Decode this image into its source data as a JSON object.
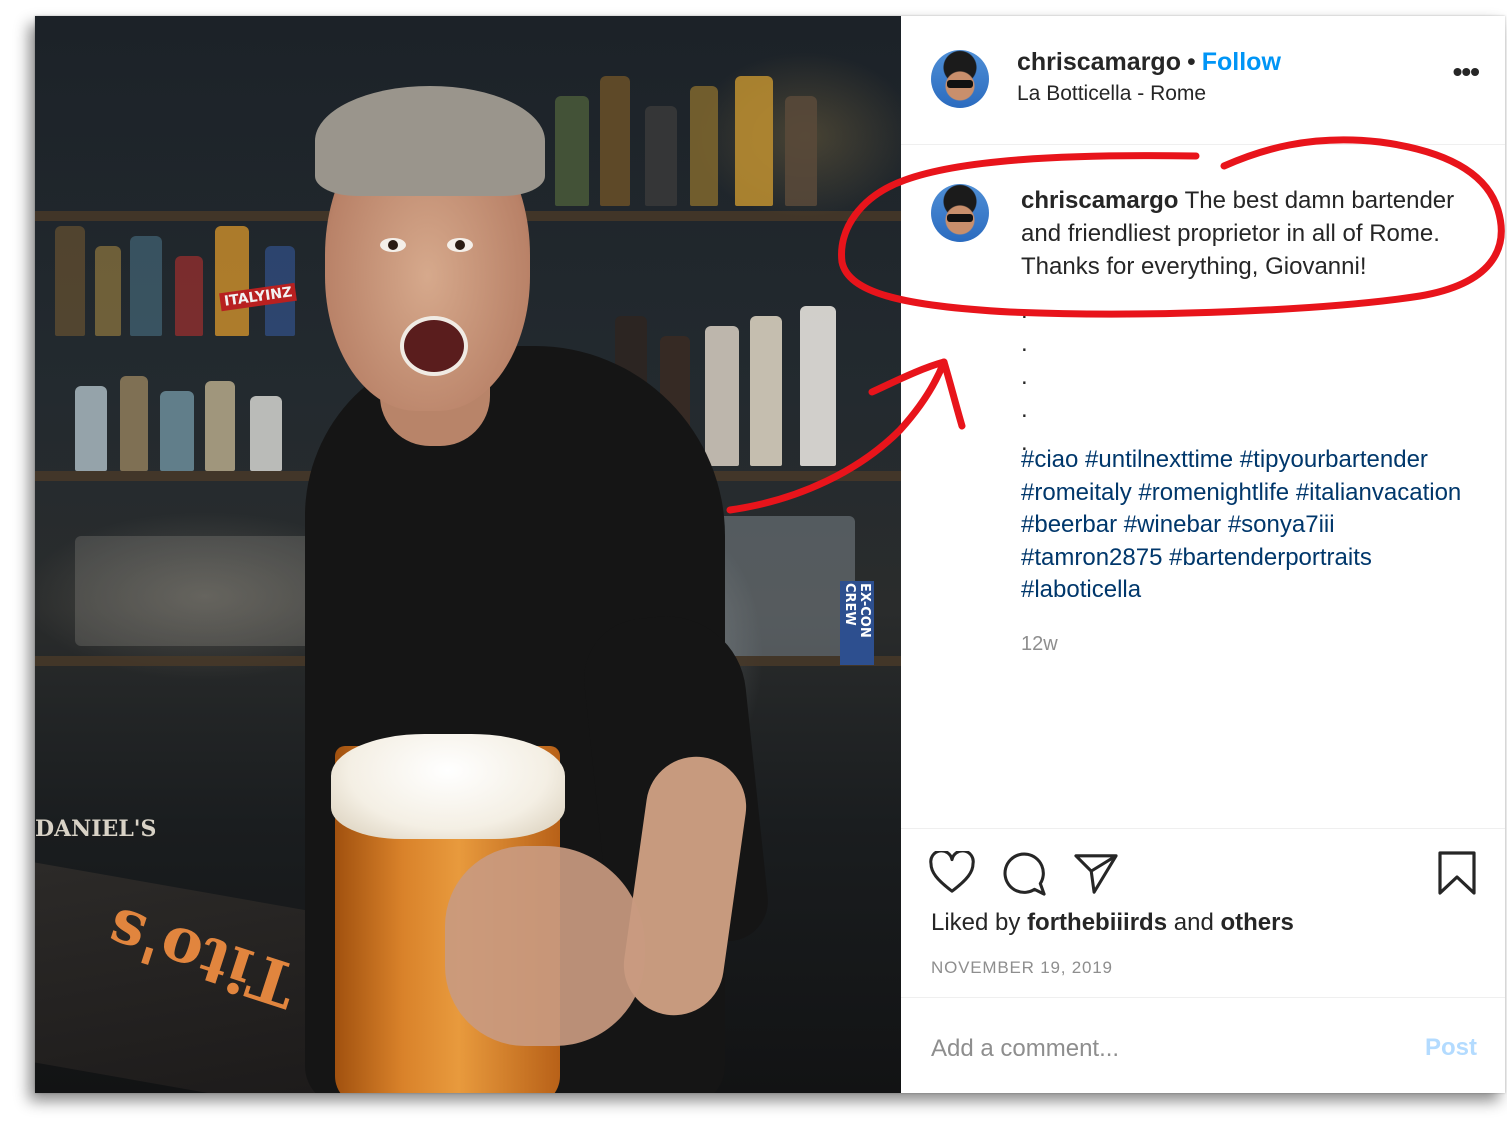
{
  "post": {
    "username": "chriscamargo",
    "header_dot": "•",
    "follow_label": "Follow",
    "location": "La Botticella - Rome",
    "more_label": "•••",
    "caption": "The best damn bartender and friendliest proprietor in all of Rome. Thanks for everything, Giovanni!",
    "dots": [
      ".",
      ".",
      ".",
      ".",
      "."
    ],
    "hashtags": [
      "#ciao",
      "#untilnexttime",
      "#tipyourbartender",
      "#romeitaly",
      "#romenightlife",
      "#italianvacation",
      "#beerbar",
      "#winebar",
      "#sonya7iii",
      "#tamron2875",
      "#bartenderportraits",
      "#laboticella"
    ],
    "time_ago": "12w",
    "liked_prefix": "Liked by",
    "liked_user": "forthebiiirds",
    "liked_and": "and",
    "liked_others": "others",
    "date": "NOVEMBER 19, 2019",
    "comment_placeholder": "Add a comment...",
    "post_label": "Post"
  },
  "photo": {
    "bar_texts": [
      "DANIEL'S",
      "EX-CON CREW",
      "Tito's",
      "ITALYINZ"
    ]
  },
  "icons": {
    "like": "heart-icon",
    "comment": "comment-icon",
    "share": "share-icon",
    "save": "bookmark-icon"
  },
  "colors": {
    "follow": "#0095f6",
    "hashtag": "#00376b",
    "annotation": "#e8141b",
    "muted": "#8e8e8e",
    "post_disabled": "#b3dbff"
  }
}
